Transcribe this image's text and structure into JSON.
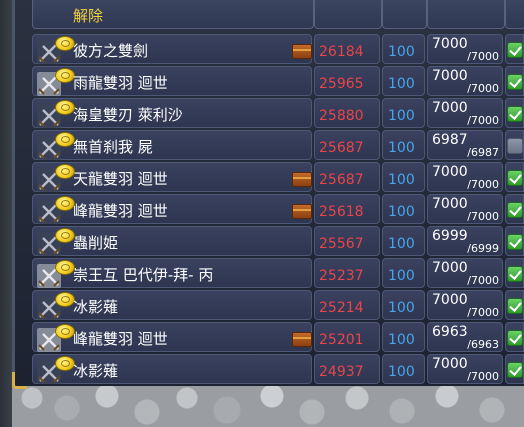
{
  "header": {
    "unlock_label": "解除"
  },
  "colors": {
    "price": "#e8454a",
    "level": "#49a3ec",
    "header_text": "#f2d23c",
    "check_on": "#3fae3c"
  },
  "icons": {
    "item": "crossed-swords-icon",
    "currency": "gold-coin-icon",
    "chest": "treasure-chest-icon"
  },
  "rows": [
    {
      "name": "彼方之雙劍",
      "price": "26184",
      "level": "100",
      "count_current": "7000",
      "count_max": "/7000",
      "checked": true,
      "has_chest": true,
      "icon_variant": "dark"
    },
    {
      "name": "雨龍雙羽 迴世",
      "price": "25965",
      "level": "100",
      "count_current": "7000",
      "count_max": "/7000",
      "checked": true,
      "has_chest": false,
      "icon_variant": "light"
    },
    {
      "name": "海皇雙刃 萊利沙",
      "price": "25880",
      "level": "100",
      "count_current": "7000",
      "count_max": "/7000",
      "checked": true,
      "has_chest": false,
      "icon_variant": "dark"
    },
    {
      "name": "無首刹我 屍",
      "price": "25687",
      "level": "100",
      "count_current": "6987",
      "count_max": "/6987",
      "checked": false,
      "has_chest": false,
      "icon_variant": "dark"
    },
    {
      "name": "天龍雙羽 迴世",
      "price": "25687",
      "level": "100",
      "count_current": "7000",
      "count_max": "/7000",
      "checked": true,
      "has_chest": true,
      "icon_variant": "dark"
    },
    {
      "name": "峰龍雙羽 迴世",
      "price": "25618",
      "level": "100",
      "count_current": "7000",
      "count_max": "/7000",
      "checked": true,
      "has_chest": true,
      "icon_variant": "dark"
    },
    {
      "name": "蟲削姫",
      "price": "25567",
      "level": "100",
      "count_current": "6999",
      "count_max": "/6999",
      "checked": true,
      "has_chest": false,
      "icon_variant": "dark"
    },
    {
      "name": "崇王互 巴代伊-拜- 丙",
      "price": "25237",
      "level": "100",
      "count_current": "7000",
      "count_max": "/7000",
      "checked": true,
      "has_chest": false,
      "icon_variant": "light"
    },
    {
      "name": "冰影薙",
      "price": "25214",
      "level": "100",
      "count_current": "7000",
      "count_max": "/7000",
      "checked": true,
      "has_chest": false,
      "icon_variant": "dark"
    },
    {
      "name": "峰龍雙羽 迴世",
      "price": "25201",
      "level": "100",
      "count_current": "6963",
      "count_max": "/6963",
      "checked": true,
      "has_chest": true,
      "icon_variant": "light"
    },
    {
      "name": "冰影薙",
      "price": "24937",
      "level": "100",
      "count_current": "7000",
      "count_max": "/7000",
      "checked": true,
      "has_chest": false,
      "icon_variant": "dark"
    }
  ]
}
